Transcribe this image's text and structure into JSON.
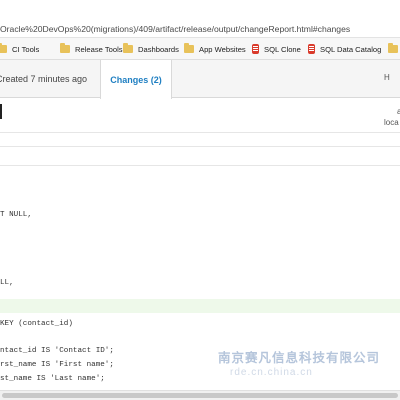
{
  "address_bar": {
    "url": "Oracle%20DevOps%20(migrations)/409/artifact/release/output/changeReport.html#changes"
  },
  "bookmarks": [
    {
      "label": "CI Tools",
      "icon": "folder-icon"
    },
    {
      "label": "Release Tools",
      "icon": "folder-icon"
    },
    {
      "label": "Dashboards",
      "icon": "folder-icon"
    },
    {
      "label": "App Websites",
      "icon": "folder-icon"
    },
    {
      "label": "SQL Clone",
      "icon": "database-icon"
    },
    {
      "label": "SQL Data Catalog",
      "icon": "database-icon"
    },
    {
      "label": "",
      "icon": "folder-icon"
    }
  ],
  "tabs": {
    "created": "Created 7 minutes ago",
    "changes": "Changes (2)",
    "right": "H"
  },
  "info": {
    "line1": "a",
    "line2": "loca"
  },
  "code": {
    "lines": [
      "T NULL,",
      "LL,",
      "KEY (contact_id)",
      "ntact_id IS 'Contact ID';",
      "rst_name IS 'First name';",
      "st_name IS 'Last name';"
    ]
  },
  "watermark": {
    "line1": "南京赛凡信息科技有限公司",
    "line2": "rde.cn.china.cn"
  },
  "colors": {
    "accent": "#1f7fc2",
    "added_line_bg": "#eef9ea"
  }
}
